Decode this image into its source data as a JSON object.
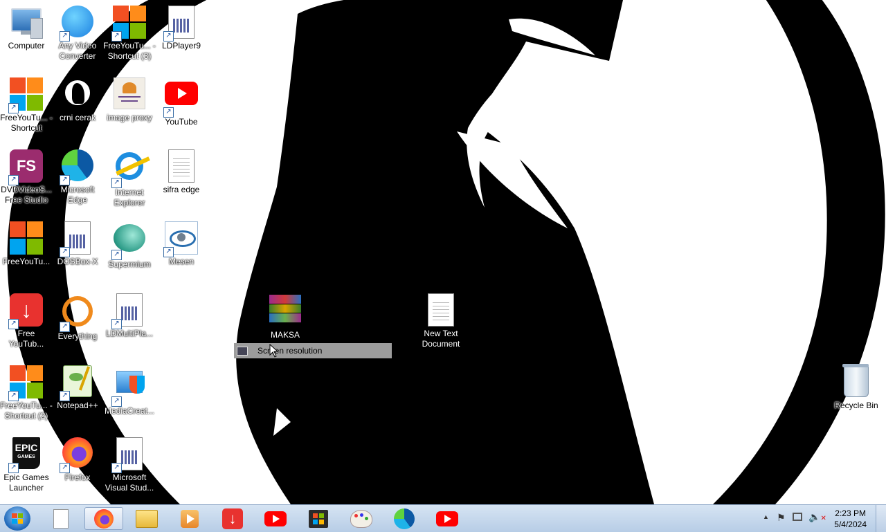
{
  "desktop": {
    "icons": [
      {
        "label": "Computer",
        "icon": "computer-icon"
      },
      {
        "label": "Any Video Converter",
        "icon": "any-video-converter-icon"
      },
      {
        "label": "FreeYouTu... - Shortcut (3)",
        "icon": "freeyoutube-icon"
      },
      {
        "label": "LDPlayer9",
        "icon": "ldplayer-icon"
      },
      {
        "label": "FreeYouTu... - Shortcut",
        "icon": "freeyoutube-icon"
      },
      {
        "label": "crni cerak",
        "icon": "crow-image-icon"
      },
      {
        "label": "image proxy",
        "icon": "image-proxy-icon"
      },
      {
        "label": "YouTube",
        "icon": "youtube-icon"
      },
      {
        "label": "DVDVideoS... Free Studio",
        "icon": "free-studio-icon"
      },
      {
        "label": "Microsoft Edge",
        "icon": "edge-icon"
      },
      {
        "label": "Internet Explorer",
        "icon": "internet-explorer-icon"
      },
      {
        "label": "sifra edge",
        "icon": "text-file-icon"
      },
      {
        "label": "FreeYouTu...",
        "icon": "freeyoutube-icon"
      },
      {
        "label": "DOSBox-X",
        "icon": "dosbox-icon"
      },
      {
        "label": "Supermium",
        "icon": "supermium-icon"
      },
      {
        "label": "Mesen",
        "icon": "mesen-icon"
      },
      {
        "label": "Free YouTub...",
        "icon": "free-youtube-download-icon"
      },
      {
        "label": "Everything",
        "icon": "everything-icon"
      },
      {
        "label": "LDMultiPla...",
        "icon": "ldmultiplayer-icon"
      },
      {
        "label": "FreeYouTu... - Shortcut (2)",
        "icon": "freeyoutube-icon"
      },
      {
        "label": "Notepad++",
        "icon": "notepadpp-icon"
      },
      {
        "label": "MediaCreat...",
        "icon": "media-creation-tool-icon"
      },
      {
        "label": "Epic Games Launcher",
        "icon": "epic-games-icon"
      },
      {
        "label": "Firefox",
        "icon": "firefox-icon"
      },
      {
        "label": "Microsoft Visual Stud...",
        "icon": "visual-studio-icon"
      },
      {
        "label": "MAKSA",
        "icon": "winrar-archive-icon"
      },
      {
        "label": "New Text Document",
        "icon": "text-file-icon"
      },
      {
        "label": "Recycle Bin",
        "icon": "recycle-bin-icon"
      }
    ],
    "context_item": {
      "label": "Screen resolution",
      "icon": "screen-resolution-icon"
    }
  },
  "taskbar": {
    "pinned": [
      "blank-document-icon",
      "firefox-icon",
      "file-explorer-icon",
      "media-player-icon",
      "download-icon",
      "youtube-icon",
      "store-icon",
      "paint-icon",
      "edge-icon",
      "youtube-icon"
    ],
    "tray_icons": [
      "show-hidden-icons-icon",
      "action-center-flag-icon",
      "network-icon",
      "volume-muted-icon"
    ],
    "clock": {
      "time": "2:23 PM",
      "date": "5/4/2024"
    }
  }
}
